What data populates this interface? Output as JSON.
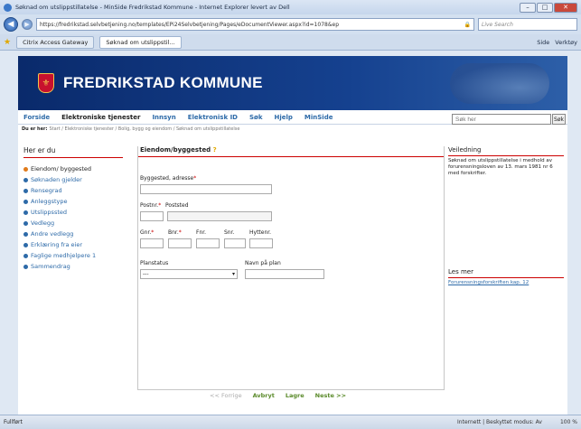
{
  "window": {
    "title": "Søknad om utslippstillatelse - MinSide Fredrikstad Kommune - Internet Explorer levert av Dell",
    "min": "–",
    "max": "□",
    "close": "✕"
  },
  "browser": {
    "address": "https://fredrikstad.selvbetjening.no/templates/EPi24Selvbetjening/Pages/eDocumentViewer.aspx?id=1078&ep",
    "search_placeholder": "Live Search",
    "tabs": [
      "Citrix Access Gateway",
      "Søknad om utslippstil..."
    ],
    "tools": [
      "Side",
      "Verktøy"
    ],
    "status": "Fullført",
    "zone": "Internett | Beskyttet modus: Av",
    "zoom": "100 %"
  },
  "site": {
    "brand": "FREDRIKSTAD KOMMUNE",
    "menu": [
      "Forside",
      "Elektroniske tjenester",
      "Innsyn",
      "Elektronisk ID",
      "Søk",
      "Hjelp",
      "MinSide"
    ],
    "search_placeholder": "Søk her",
    "search_button": "Søk",
    "crumbs_label": "Du er her:",
    "crumbs": "Start / Elektroniske tjenester / Bolig, bygg og eiendom / Søknad om utslippstillatelse"
  },
  "sidebar": {
    "heading": "Her er du",
    "steps": [
      "Eiendom/ byggested",
      "Søknaden gjelder",
      "Rensegrad",
      "Anleggstype",
      "Utslippssted",
      "Vedlegg",
      "Andre vedlegg",
      "Erklæring fra eier",
      "Faglige medhjelpere 1",
      "Sammendrag"
    ]
  },
  "form": {
    "heading": "Eiendom/byggested",
    "help": "?",
    "byggested_label": "Byggested, adresse",
    "postnr_label": "Postnr.",
    "poststed_label": "Poststed",
    "gnr": "Gnr.",
    "bnr": "Bnr.",
    "fnr": "Fnr.",
    "snr": "Snr.",
    "hyttenr": "Hyttenr.",
    "planstatus_label": "Planstatus",
    "planstatus_value": "---",
    "navn_plan_label": "Navn på plan",
    "req": "*"
  },
  "guidance": {
    "heading": "Veiledning",
    "text": "Søknad om utslippstillatelse i medhold av forurensningsloven av 13. mars 1981 nr 6 med forskrifter."
  },
  "lesmer": {
    "heading": "Les mer",
    "link": "Forurensningsforskriften kap. 12"
  },
  "pager": {
    "prev": "<< Forrige",
    "cancel": "Avbryt",
    "save": "Lagre",
    "next": "Neste >>"
  }
}
